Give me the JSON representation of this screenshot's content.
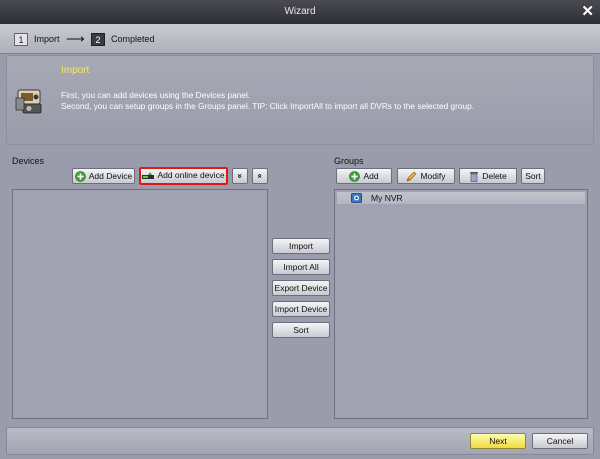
{
  "window": {
    "title": "Wizard"
  },
  "steps": [
    {
      "number": "1",
      "label": "Import"
    },
    {
      "number": "2",
      "label": "Completed"
    }
  ],
  "info": {
    "title": "Import",
    "lines": [
      "First, you can add devices using the Devices panel.",
      "Second, you can setup groups in the Groups panel. TIP: Click ImportAll to import all DVRs to the selected group."
    ]
  },
  "devices": {
    "label": "Devices",
    "add_device": "Add Device",
    "add_online_device": "Add online device",
    "collapse_glyph": "»",
    "expand_glyph": "«"
  },
  "middle": {
    "import": "Import",
    "import_all": "Import All",
    "export_device": "Export Device",
    "import_device": "Import Device",
    "sort": "Sort"
  },
  "groups": {
    "label": "Groups",
    "add": "Add",
    "modify": "Modify",
    "delete": "Delete",
    "sort": "Sort",
    "items": [
      {
        "label": "My NVR"
      }
    ]
  },
  "footer": {
    "next": "Next",
    "cancel": "Cancel"
  },
  "colors": {
    "highlight": "#e01818",
    "info_title": "#f5ea60",
    "next_button": "#eedb3e"
  }
}
